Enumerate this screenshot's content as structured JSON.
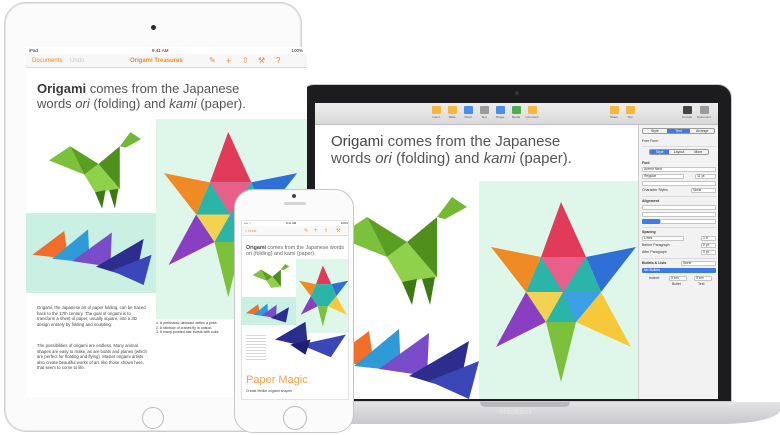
{
  "ipad": {
    "status": {
      "carrier": "iPad",
      "time": "9:41 AM",
      "battery": "100%"
    },
    "nav": {
      "back": "Documents",
      "undo": "Undo",
      "title": "Origami Treasures"
    },
    "heading": {
      "bold": "Origami",
      "rest1": " comes from the Japanese words ",
      "ori": "ori",
      "mid": " (folding) and ",
      "kami": "kami",
      "end": " (paper)."
    },
    "paragraph1": "Origami, the Japanese art of paper folding, can be traced back to the 17th century. The goal of origami is to transform a sheet of paper, usually square, into a 3D design entirely by folding and sculpting.",
    "paragraph2": "The possibilities of origami are endless. Many animal shapes are easy to make, as are boats and planes (which are perfect for floating and flying). Master origami artists also create beautiful works of art, like those shown here, that seem to come to life.",
    "captions": [
      "1. A prehistoric dinosaur defies a pose.",
      "2. A rainbow of cranes fly in unison.",
      "3. A many-pointed star bursts with color."
    ]
  },
  "iphone": {
    "status": {
      "carrier": "•••• ⌔",
      "time": "9:41 AM",
      "battery": "100%"
    },
    "nav": {
      "back": "< Undo"
    },
    "heading": {
      "bold": "Origami",
      "rest": " comes from the Japanese words ori (folding) and kami (paper)."
    },
    "paper_title": "Paper Magic",
    "paper_sub": "Create lifelike origami shapes"
  },
  "mac": {
    "label": "MacBook",
    "toolbar": [
      {
        "label": "Insert",
        "color": "orange"
      },
      {
        "label": "Table",
        "color": "orange"
      },
      {
        "label": "Chart",
        "color": "blue"
      },
      {
        "label": "Text",
        "color": "grey"
      },
      {
        "label": "Shape",
        "color": "blue"
      },
      {
        "label": "Media",
        "color": "green"
      },
      {
        "label": "Comment",
        "color": "orange"
      }
    ],
    "toolbar_right": [
      "Share",
      "Tips",
      "Format",
      "Document"
    ],
    "heading": {
      "bold": "Origami",
      "rest1": " comes from the Japanese",
      "line2a": "words ",
      "ori": "ori",
      "mid": " (folding) and ",
      "kami": "kami",
      "end": " (paper)."
    },
    "inspector": {
      "tabs": [
        "Style",
        "Text",
        "Arrange"
      ],
      "style_name": "Free Form",
      "subtabs": [
        "Style",
        "Layout",
        "More"
      ],
      "font_label": "Font",
      "font_name": "Avenir Next",
      "font_style": "Regular",
      "font_size": "11 pt",
      "char_styles_label": "Character Styles",
      "char_styles_value": "None",
      "alignment_label": "Alignment",
      "spacing_label": "Spacing",
      "spacing_value": "Lines",
      "spacing_num": "1.0",
      "before_label": "Before Paragraph",
      "before_value": "0 pt",
      "after_label": "After Paragraph",
      "after_value": "0 pt",
      "bullets_label": "Bullets & Lists",
      "bullets_value": "None",
      "bullets_sel": "No Bullets",
      "indent_label": "Indent:",
      "indent_bullet": "Bullet",
      "indent_text": "Text",
      "indent_val": "0 cm"
    }
  },
  "colors": {
    "accent": "#f08a24",
    "inspector_blue": "#3d7ce6",
    "mint_bg": "#dff7ea",
    "teal_bg": "#c9f0e2"
  }
}
